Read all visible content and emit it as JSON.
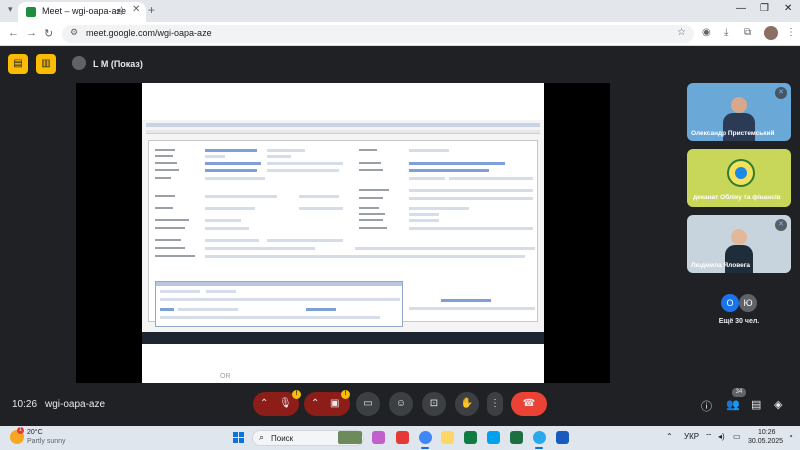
{
  "browser": {
    "tab_title": "Meet – wgi-oapa-aze",
    "url": "meet.google.com/wgi-oapa-aze"
  },
  "meet": {
    "presenter_label": "L M (Показ)",
    "time": "10:26",
    "meeting_code": "wgi-oapa-aze",
    "participant_count_badge": "34",
    "participants": [
      {
        "name": "Олександр Пристемський",
        "muted": true
      },
      {
        "name": "деканат Обліку та фінансів",
        "muted": false
      },
      {
        "name": "Людмила Яловега",
        "muted": true
      }
    ],
    "more": {
      "initials": [
        "О",
        "Ю"
      ],
      "label": "Ещё 30 чел."
    },
    "warning_mark": "!",
    "shared_screen_zoom": "OR",
    "colors": {
      "accent_yellow": "#fbbc04",
      "hangup_red": "#ea4335",
      "mic_off_red": "#8c1d18",
      "avatar_blue": "#1a73e8",
      "avatar_grey": "#5f6368"
    }
  },
  "taskbar": {
    "weather_temp": "20°C",
    "weather_condition": "Partly sunny",
    "weather_badge": "1",
    "search_placeholder": "Поиск",
    "language": "УКР",
    "time": "10:26",
    "date": "30.05.2025"
  }
}
